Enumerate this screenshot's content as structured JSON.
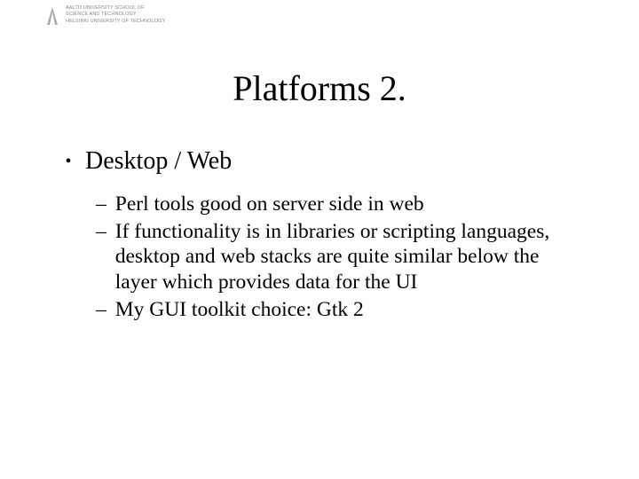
{
  "affiliation": {
    "line1": "AALTO UNIVERSITY SCHOOL OF",
    "line2": "SCIENCE AND TECHNOLOGY",
    "line3": "HELSINKI UNIVERSITY OF TECHNOLOGY"
  },
  "title": "Platforms 2.",
  "bullets": {
    "main": "Desktop / Web",
    "subs": [
      "Perl tools good on server side in web",
      "If functionality is in libraries or scripting languages, desktop and web stacks are quite similar below the layer which provides data for the UI",
      "My GUI toolkit choice: Gtk 2"
    ]
  }
}
